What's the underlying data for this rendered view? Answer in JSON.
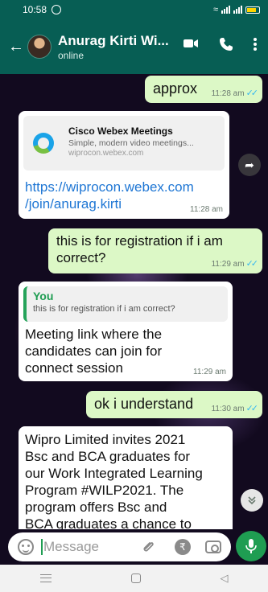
{
  "status_bar": {
    "time": "10:58"
  },
  "header": {
    "contact_name": "Anurag Kirti Wi...",
    "status": "online"
  },
  "messages": [
    {
      "text": "approx",
      "time": "11:28 am"
    },
    {
      "preview_title": "Cisco Webex Meetings",
      "preview_desc": "Simple, modern video meetings...",
      "preview_domain": "wiprocon.webex.com",
      "link_line1": "https://wiprocon.webex.com",
      "link_line2": "/join/anurag.kirti",
      "time": "11:28 am"
    },
    {
      "line1": "this is for registration if i am",
      "line2": "correct?",
      "time": "11:29 am"
    },
    {
      "quote_author": "You",
      "quote_text": "this is for registration if i am correct?",
      "line1": "Meeting link where the",
      "line2": "candidates can join for",
      "line3": "connect session",
      "time": "11:29 am"
    },
    {
      "text": "ok i understand",
      "time": "11:30 am"
    },
    {
      "line1": "Wipro Limited invites 2021",
      "line2": "Bsc and BCA graduates for",
      "line3": "our Work Integrated Learning",
      "line4": "Program #WILP2021. The",
      "line5": "program offers Bsc and",
      "line6": "BCA graduates a chance to"
    }
  ],
  "composer": {
    "placeholder": "Message"
  },
  "icons": {
    "back": "arrow-left-icon",
    "video": "video-call-icon",
    "call": "phone-icon",
    "menu": "more-vert-icon",
    "emoji": "emoji-icon",
    "attach": "paperclip-icon",
    "payment": "rupee-icon",
    "camera": "camera-icon",
    "mic": "mic-icon"
  },
  "colors": {
    "header": "#075e54",
    "outgoing_bubble": "#dcf8c6",
    "incoming_bubble": "#ffffff",
    "accent": "#1f9d52",
    "link": "#1e76d4",
    "read_ticks": "#34b7f1"
  }
}
